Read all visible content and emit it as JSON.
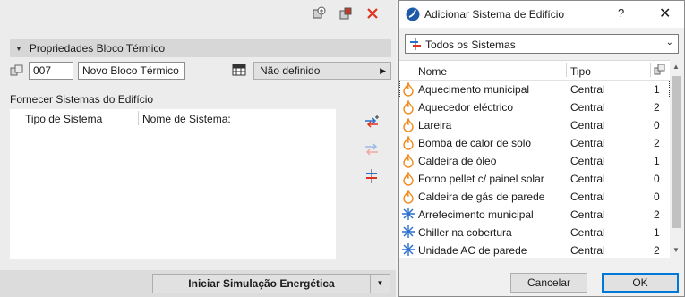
{
  "left": {
    "section_title": "Propriedades Bloco Térmico",
    "id_value": "007",
    "name_value": "Novo Bloco Térmico",
    "type_dropdown": "Não definido",
    "systems_label": "Fornecer Sistemas do Edifício",
    "table_headers": [
      "Tipo de Sistema",
      "Nome de Sistema:"
    ],
    "simulate_button": "Iniciar Simulação Energética"
  },
  "dialog": {
    "title": "Adicionar Sistema de Edifício",
    "help": "?",
    "close": "✕",
    "filter": "Todos os Sistemas",
    "columns": {
      "name": "Nome",
      "type": "Tipo"
    },
    "rows": [
      {
        "name": "Aquecimento municipal",
        "type": "Central",
        "count": "1",
        "icon": "flame-icon"
      },
      {
        "name": "Aquecedor eléctrico",
        "type": "Central",
        "count": "2",
        "icon": "flame-icon"
      },
      {
        "name": "Lareira",
        "type": "Central",
        "count": "0",
        "icon": "flame-icon"
      },
      {
        "name": "Bomba de calor de solo",
        "type": "Central",
        "count": "2",
        "icon": "flame-icon"
      },
      {
        "name": "Caldeira de óleo",
        "type": "Central",
        "count": "1",
        "icon": "flame-icon"
      },
      {
        "name": "Forno pellet c/ painel solar",
        "type": "Central",
        "count": "0",
        "icon": "flame-icon"
      },
      {
        "name": "Caldeira de gás de parede",
        "type": "Central",
        "count": "0",
        "icon": "flame-icon"
      },
      {
        "name": "Arrefecimento municipal",
        "type": "Central",
        "count": "2",
        "icon": "snowflake-icon"
      },
      {
        "name": "Chiller na cobertura",
        "type": "Central",
        "count": "1",
        "icon": "snowflake-icon"
      },
      {
        "name": "Unidade AC de parede",
        "type": "Central",
        "count": "2",
        "icon": "snowflake-icon"
      }
    ],
    "cancel": "Cancelar",
    "ok": "OK"
  },
  "colors": {
    "accent": "#0078d7",
    "flame": "#f08a1c",
    "snow": "#2a6fcf",
    "close_red": "#e0301e"
  }
}
